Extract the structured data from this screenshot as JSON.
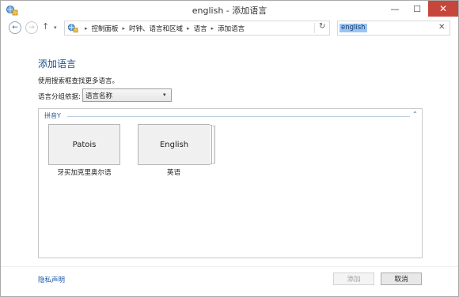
{
  "window": {
    "title": "english - 添加语言",
    "min_glyph": "—",
    "max_glyph": "☐",
    "close_glyph": "✕"
  },
  "nav": {
    "back_glyph": "←",
    "forward_glyph": "→",
    "up_glyph": "↑",
    "recent_glyph": "▾",
    "breadcrumbs": [
      "控制面板",
      "时钟、语言和区域",
      "语言",
      "添加语言"
    ],
    "sep_glyph": "▸",
    "dropdown_glyph": "▾",
    "refresh_glyph": "↻"
  },
  "search": {
    "value": "english",
    "clear_glyph": "✕"
  },
  "content": {
    "title": "添加语言",
    "instruction": "使用搜索框查找更多语言。",
    "groupby_label": "语言分组依据:",
    "groupby_value": "语言名称",
    "groupby_arrow": "▾",
    "group_header": "拼音Y",
    "group_collapse_glyph": "⌃",
    "languages": [
      {
        "tile": "Patois",
        "label": "牙买加克里奥尔语"
      },
      {
        "tile": "English",
        "label": "英语"
      }
    ]
  },
  "footer": {
    "privacy": "隐私声明",
    "add": "添加",
    "cancel": "取消"
  },
  "colors": {
    "accent": "#1c4d8c",
    "close_button": "#c7463b",
    "search_highlight": "#99c5f2"
  }
}
